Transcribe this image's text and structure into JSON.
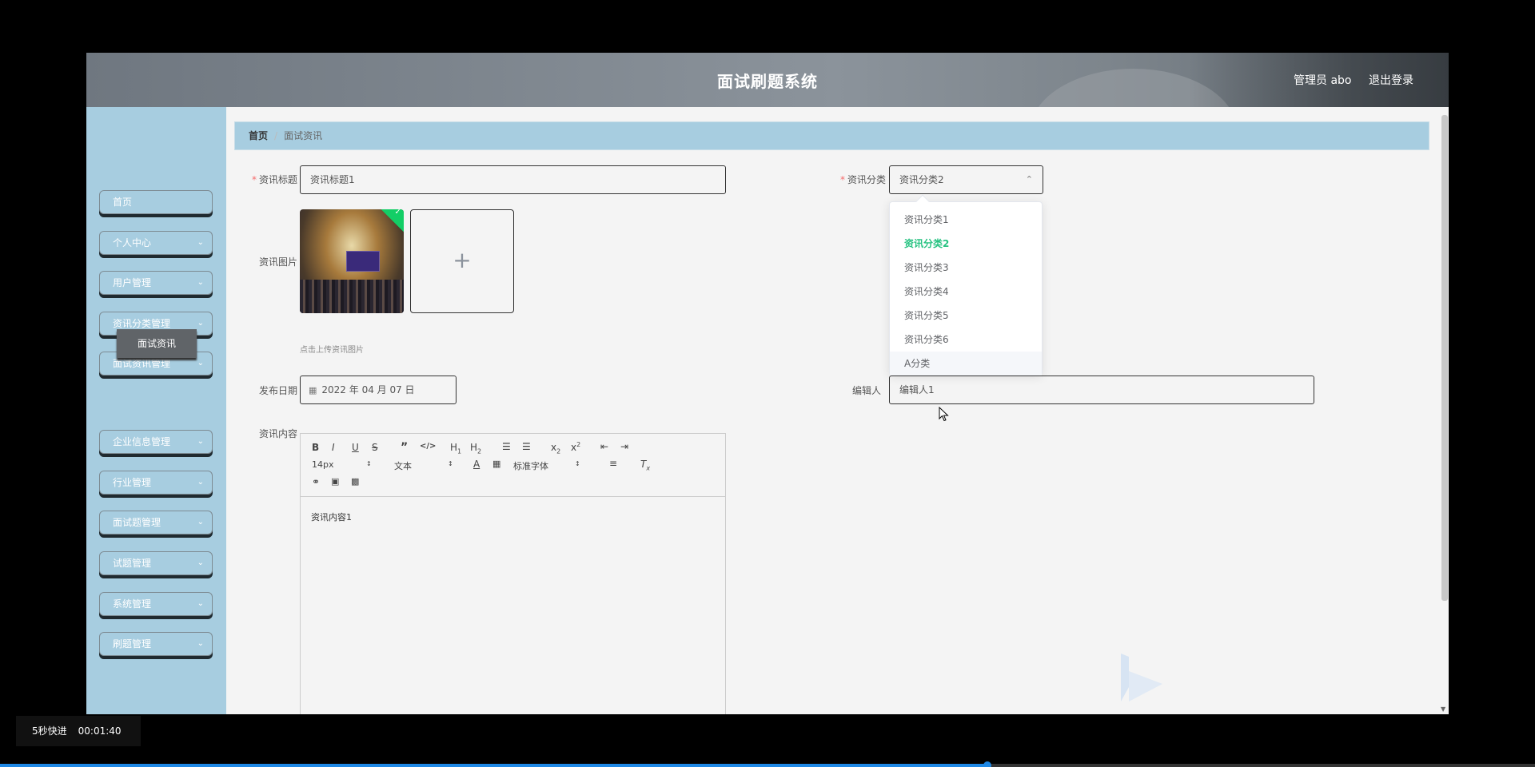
{
  "header": {
    "title": "面试刷题系统",
    "user": "管理员 abo",
    "logout": "退出登录"
  },
  "sidebar": {
    "items": [
      {
        "label": "首页",
        "has_arrow": false
      },
      {
        "label": "个人中心",
        "has_arrow": true
      },
      {
        "label": "用户管理",
        "has_arrow": true
      },
      {
        "label": "资讯分类管理",
        "has_arrow": true
      },
      {
        "label": "面试资讯管理",
        "has_arrow": true
      },
      {
        "label": "企业信息管理",
        "has_arrow": true
      },
      {
        "label": "行业管理",
        "has_arrow": true
      },
      {
        "label": "面试题管理",
        "has_arrow": true
      },
      {
        "label": "试题管理",
        "has_arrow": true
      },
      {
        "label": "系统管理",
        "has_arrow": true
      },
      {
        "label": "刷题管理",
        "has_arrow": true
      }
    ],
    "submenu": "面试资讯"
  },
  "breadcrumb": {
    "home": "首页",
    "current": "面试资讯"
  },
  "form": {
    "title_label": "资讯标题",
    "title_value": "资讯标题1",
    "category_label": "资讯分类",
    "category_value": "资讯分类2",
    "image_label": "资讯图片",
    "upload_hint": "点击上传资讯图片",
    "date_label": "发布日期",
    "date_value": "2022 年 04 月 07 日",
    "editor_label": "编辑人",
    "editor_value": "编辑人1",
    "content_label": "资讯内容",
    "content_value": "资讯内容1"
  },
  "toolbar": {
    "font_size": "14px",
    "header": "文本",
    "font": "标准字体"
  },
  "dropdown": {
    "options": [
      "资讯分类1",
      "资讯分类2",
      "资讯分类3",
      "资讯分类4",
      "资讯分类5",
      "资讯分类6",
      "A分类"
    ],
    "selected": "资讯分类2",
    "hovered": "A分类"
  },
  "overlay": {
    "speed_label": "5秒快进",
    "time": "00:01:40"
  },
  "playback_progress": 0.643,
  "colors": {
    "sidebar_bg": "#a7cde0",
    "selected_option": "#26c281",
    "progress": "#1e88e5"
  }
}
